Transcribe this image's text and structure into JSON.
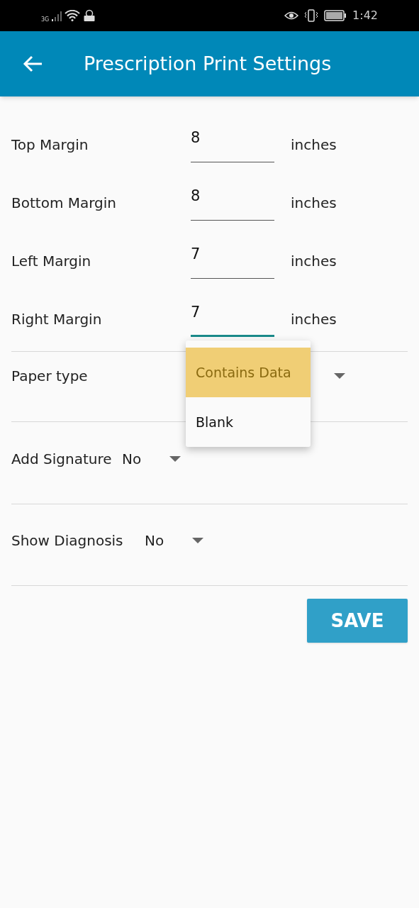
{
  "status_bar": {
    "network": "3G",
    "time": "1:42"
  },
  "app_bar": {
    "title": "Prescription Print Settings"
  },
  "margins": [
    {
      "label": "Top Margin",
      "value": "8",
      "unit": "inches",
      "focused": false
    },
    {
      "label": "Bottom Margin",
      "value": "8",
      "unit": "inches",
      "focused": false
    },
    {
      "label": "Left Margin",
      "value": "7",
      "unit": "inches",
      "focused": false
    },
    {
      "label": "Right Margin",
      "value": "7",
      "unit": "inches",
      "focused": true
    }
  ],
  "paper_type": {
    "label": "Paper type",
    "expanded": true,
    "options": [
      {
        "label": "Contains Data",
        "selected": true
      },
      {
        "label": "Blank",
        "selected": false
      }
    ]
  },
  "selects": [
    {
      "label": "Add Signature",
      "value": "No"
    },
    {
      "label": "Show Diagnosis",
      "value": "No"
    }
  ],
  "save_button": "SAVE"
}
